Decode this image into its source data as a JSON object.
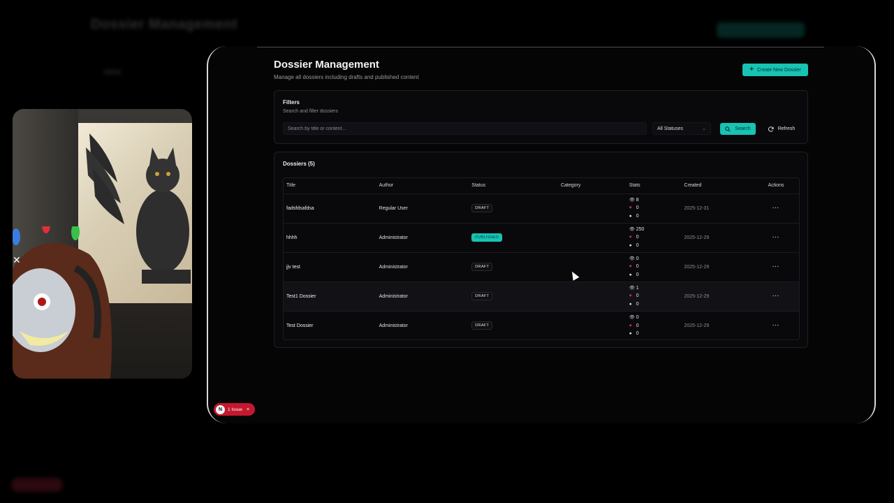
{
  "background": {
    "title": "Dossier Management"
  },
  "header": {
    "title": "Dossier Management",
    "subtitle": "Manage all dossiers including drafts and published content",
    "create_label": "Create New Dossier"
  },
  "filters": {
    "title": "Filters",
    "subtitle": "Search and filter dossiers",
    "search_placeholder": "Search by title or content...",
    "status_value": "All Statuses",
    "search_label": "Search",
    "refresh_label": "Refresh"
  },
  "dossiers": {
    "title": "Dossiers (5)",
    "columns": [
      "Title",
      "Author",
      "Status",
      "Category",
      "Stats",
      "Created",
      "Actions"
    ],
    "rows": [
      {
        "title": "fadsfdsafdsa",
        "author": "Regular User",
        "status": "DRAFT",
        "category": "",
        "views": "8",
        "likes": "0",
        "comments": "0",
        "created": "2025-12-31",
        "actions": "···"
      },
      {
        "title": "hhhh",
        "author": "Administrator",
        "status": "PUBLISHED",
        "category": "",
        "views": "250",
        "likes": "0",
        "comments": "0",
        "created": "2025-12-29",
        "actions": "···"
      },
      {
        "title": "jjv test",
        "author": "Administrator",
        "status": "DRAFT",
        "category": "",
        "views": "0",
        "likes": "0",
        "comments": "0",
        "created": "2025-12-29",
        "actions": "···"
      },
      {
        "title": "Test1 Dossier",
        "author": "Administrator",
        "status": "DRAFT",
        "category": "",
        "views": "1",
        "likes": "0",
        "comments": "0",
        "created": "2025-12-29",
        "actions": "···"
      },
      {
        "title": "Test Dossier",
        "author": "Administrator",
        "status": "DRAFT",
        "category": "",
        "views": "0",
        "likes": "0",
        "comments": "0",
        "created": "2025-12-29",
        "actions": "···"
      }
    ]
  },
  "issue": {
    "badge_letter": "N",
    "label": "1 Issue",
    "close": "×"
  },
  "colors": {
    "accent": "#17c3b2",
    "issue": "#c4182f",
    "background": "#000000"
  }
}
